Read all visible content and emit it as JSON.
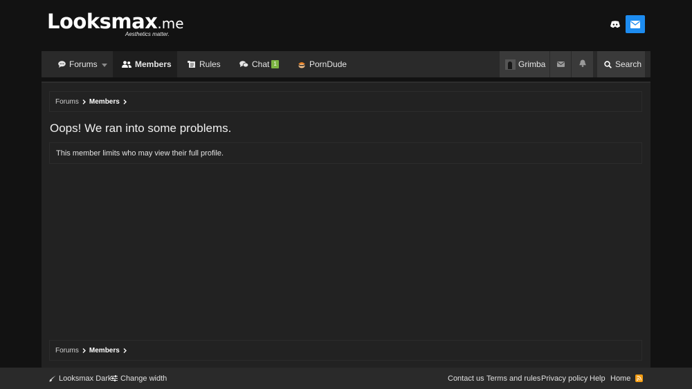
{
  "header": {
    "logo_text": "Looksmax",
    "logo_tld": ".me",
    "tagline": "Aesthetics matter.",
    "icons": [
      "discord-icon",
      "envelope-icon"
    ]
  },
  "nav": {
    "forums": "Forums",
    "members": "Members",
    "rules": "Rules",
    "chat": "Chat",
    "chat_badge": "1",
    "porndude": "PornDude",
    "user": "Grimba",
    "search": "Search"
  },
  "breadcrumb": {
    "items": [
      "Forums",
      "Members"
    ]
  },
  "error": {
    "title": "Oops! We ran into some problems.",
    "message": "This member limits who may view their full profile."
  },
  "footer": {
    "style": "Looksmax Dark",
    "width": "Change width",
    "links": [
      "Contact us",
      "Terms and rules",
      "Privacy policy",
      "Help",
      "Home"
    ]
  },
  "colors": {
    "background": "#121212",
    "accent_blue": "#1d8cf0",
    "badge_green": "#7cb342",
    "rss_orange": "#f39c12"
  }
}
